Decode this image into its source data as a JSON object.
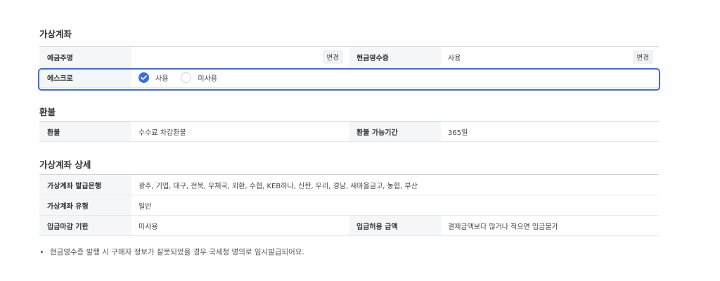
{
  "virtual_account": {
    "title": "가상계좌",
    "depositor_label": "예금주명",
    "depositor_value": "",
    "change_label": "변경",
    "cash_receipt_label": "현금영수증",
    "cash_receipt_value": "사용",
    "escrow_label": "에스크로",
    "escrow_options": [
      "사용",
      "미사용"
    ],
    "escrow_selected": "사용"
  },
  "refund": {
    "title": "환불",
    "refund_label": "환불",
    "refund_value": "수수료 차감환불",
    "period_label": "환불 가능기간",
    "period_value": "365일"
  },
  "detail": {
    "title": "가상계좌 상세",
    "banks_label": "가상계좌 발급은행",
    "banks_value": "광주, 기업, 대구, 전북, 우체국, 외환, 수협, KEB하나, 신한, 우리, 경남, 새마을금고, 농협, 부산",
    "type_label": "가상계좌 유형",
    "type_value": "일반",
    "deadline_label": "입금마감 기한",
    "deadline_value": "미사용",
    "amount_label": "입금허용 금액",
    "amount_value": "결제금액보다 많거나 적으면 입금불가"
  },
  "note": "현금영수증 발행 시 구매자 정보가 잘못되었을 경우 국세청 명의로 임시발급되어요.",
  "colors": {
    "accent": "#3b6fe0",
    "header_bg": "#f5f6f8"
  }
}
